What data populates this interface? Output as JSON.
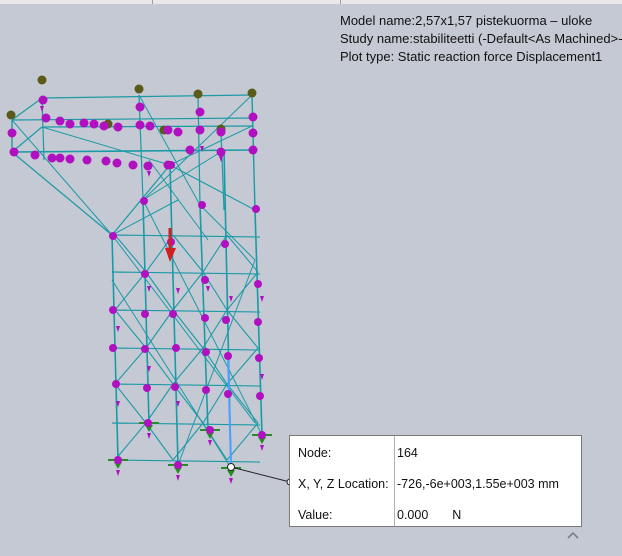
{
  "header": {
    "model_name": "Model name:2,57x1,57 pistekuorma – uloke",
    "study_name": "Study name:stabiliteetti (-Default<As Machined>-",
    "plot_type": "Plot type: Static reaction force Displacement1"
  },
  "probe": {
    "node_label": "Node:",
    "node_value": "164",
    "location_label": "X, Y, Z Location:",
    "location_value": "-726,-6e+003,1.55e+003 mm",
    "value_label": "Value:",
    "value_value": "0.000",
    "value_unit": "N"
  },
  "colors": {
    "background": "#c5c9d3",
    "beam": "#1b9aa6",
    "node": "#b010c0",
    "top_node": "#5a5a1a",
    "fixture": "#2a8a2a",
    "load": "#d02020",
    "selected_beam": "#4aa0ff"
  },
  "icons": {
    "collapse": "chevron-up-icon"
  }
}
